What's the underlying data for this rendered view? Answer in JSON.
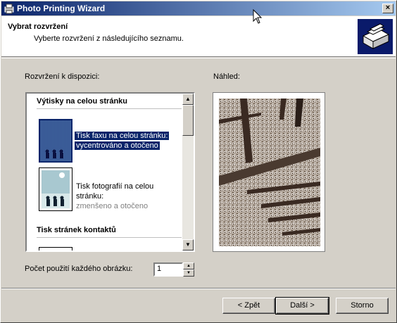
{
  "window": {
    "title": "Photo Printing Wizard",
    "close_label": "×"
  },
  "header": {
    "title": "Vybrat rozvržení",
    "subtitle": "Vyberte rozvržení z následujícího seznamu."
  },
  "layouts": {
    "label": "Rozvržení k dispozici:",
    "groups": [
      {
        "title": "Výtisky na celou stránku",
        "items": [
          {
            "line1": "Tisk faxu na celou stránku:",
            "line2": "vycentrováno a otočeno",
            "selected": true
          },
          {
            "line1": "Tisk fotografií na celou stránku:",
            "line2": "zmenšeno a otočeno",
            "selected": false
          }
        ]
      },
      {
        "title": "Tisk stránek kontaktů",
        "items": []
      }
    ]
  },
  "preview": {
    "label": "Náhled:"
  },
  "count": {
    "label": "Počet použití každého obrázku:",
    "value": "1"
  },
  "buttons": {
    "back": "< Zpět",
    "next": "Další >",
    "cancel": "Storno"
  }
}
